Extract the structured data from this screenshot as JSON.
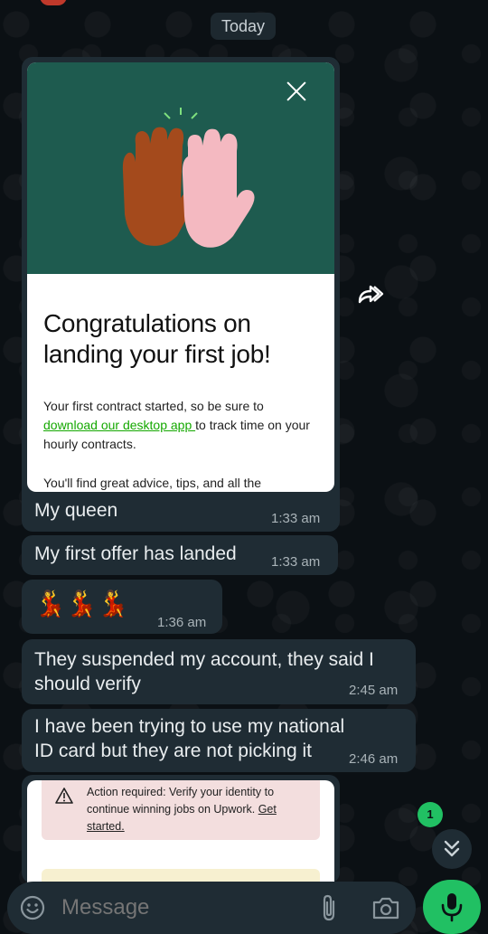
{
  "date_chip": "Today",
  "card": {
    "title": "Congratulations on landing your first job!",
    "body_before_link": "Your first contract started, so be sure to ",
    "link": "download our desktop app ",
    "body_after_link": "to track time on your hourly contracts.",
    "body2": "You'll find great advice, tips, and all the"
  },
  "messages": [
    {
      "text": "My queen",
      "time": "1:33 am"
    },
    {
      "text": "My first offer has landed",
      "time": "1:33 am"
    },
    {
      "text": "💃💃💃",
      "time": "1:36 am"
    },
    {
      "text": "They suspended my account, they said I should verify",
      "time": "2:45 am"
    },
    {
      "text": "I have been trying to use my national ID card but they are not picking it",
      "time": "2:46 am"
    }
  ],
  "card2": {
    "alert_text": "Action required: Verify your identity to continue winning jobs on Upwork. ",
    "alert_link": "Get started."
  },
  "unread_count": "1",
  "composer": {
    "placeholder": "Message"
  },
  "colors": {
    "background": "#0b1014",
    "bubble": "#1f2c34",
    "accent": "#21c063",
    "card_header": "#1e5b4f",
    "link_green": "#14a800"
  },
  "icons": [
    "forward-icon",
    "close-icon",
    "warning-icon",
    "emoji-icon",
    "paperclip-icon",
    "camera-icon",
    "mic-icon",
    "chevron-double-down-icon"
  ]
}
